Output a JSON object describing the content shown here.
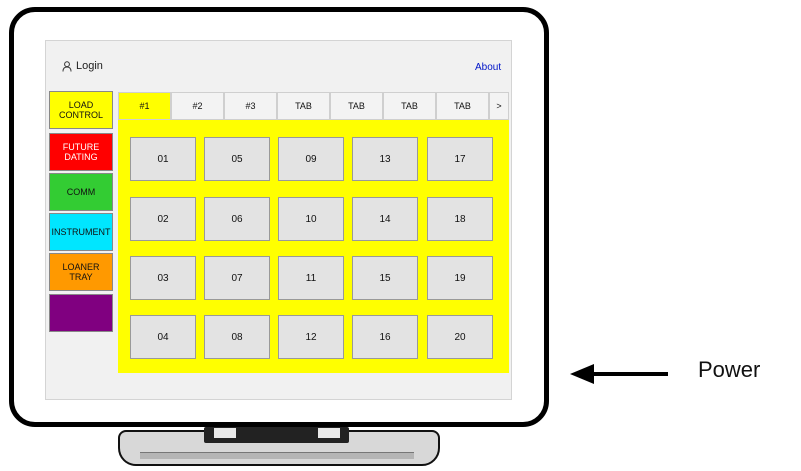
{
  "header": {
    "login_label": "Login",
    "about_label": "About"
  },
  "sidebar": {
    "items": [
      {
        "label": "LOAD CONTROL",
        "bg": "#ffff00",
        "fg": "#111111"
      },
      {
        "label": "FUTURE DATING",
        "bg": "#ff0000",
        "fg": "#ffffff"
      },
      {
        "label": "COMM",
        "bg": "#33cc33",
        "fg": "#111111"
      },
      {
        "label": "INSTRUMENT",
        "bg": "#00e6ff",
        "fg": "#111111"
      },
      {
        "label": "LOANER TRAY",
        "bg": "#ff9900",
        "fg": "#111111"
      },
      {
        "label": "",
        "bg": "#800080",
        "fg": "#ffffff"
      }
    ]
  },
  "tabs": [
    "#1",
    "#2",
    "#3",
    "TAB",
    "TAB",
    "TAB",
    "TAB"
  ],
  "tab_next": ">",
  "grid": [
    "01",
    "05",
    "09",
    "13",
    "17",
    "02",
    "06",
    "10",
    "14",
    "18",
    "03",
    "07",
    "11",
    "15",
    "19",
    "04",
    "08",
    "12",
    "16",
    "20"
  ],
  "annotation": {
    "power_label": "Power"
  },
  "colors": {
    "active_tab": "#ffff00",
    "panel": "#ffff00"
  }
}
